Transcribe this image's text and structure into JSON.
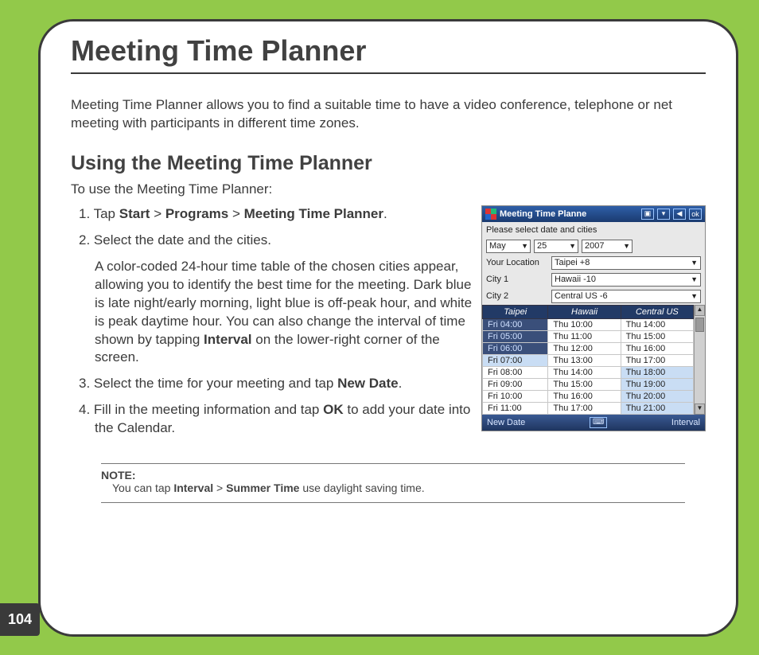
{
  "page": {
    "title": "Meeting Time Planner",
    "intro": "Meeting Time Planner allows you to find a suitable time to have a video conference, telephone or net meeting with participants in different time zones.",
    "section_heading": "Using the Meeting Time Planner",
    "section_lead": "To use the Meeting Time Planner:",
    "page_number": "104"
  },
  "steps": {
    "s1_prefix": "1.  Tap ",
    "s1_b1": "Start",
    "s1_sep1": " > ",
    "s1_b2": "Programs",
    "s1_sep2": " > ",
    "s1_b3": "Meeting Time Planner",
    "s1_end": ".",
    "s2": "2.   Select the date and the cities.",
    "s2_sub_a": "A color-coded 24-hour time table of the chosen cities appear, allowing you to identify the best time for the meeting. Dark blue is late night/early morning, light blue is off-peak hour, and white is peak daytime hour. You can also change the interval of time shown by tapping ",
    "s2_sub_bold": "Interval",
    "s2_sub_b": " on the lower-right corner of the screen.",
    "s3_a": "3. Select the time for your meeting and tap ",
    "s3_bold": "New Date",
    "s3_b": ".",
    "s4_a": "4. Fill in the meeting information and tap ",
    "s4_bold": "OK",
    "s4_b": " to add your date into the Calendar."
  },
  "note": {
    "label": "NOTE:",
    "a": "You can tap ",
    "b1": "Interval",
    "sep": " > ",
    "b2": "Summer Time",
    "c": " use daylight saving time."
  },
  "device": {
    "title": "Meeting Time Planne",
    "ok": "ok",
    "instruction": "Please select date and cities",
    "month": "May",
    "day": "25",
    "year": "2007",
    "loc_label": "Your Location",
    "city1_label": "City 1",
    "city2_label": "City 2",
    "loc_value": "Taipei +8",
    "city1_value": "Hawaii -10",
    "city2_value": "Central US -6",
    "headers": [
      "Taipei",
      "Hawaii",
      "Central US"
    ],
    "rows": [
      {
        "c0": "Fri 04:00",
        "c1": "Thu 10:00",
        "c2": "Thu 14:00",
        "cls": [
          "dk",
          "",
          ""
        ]
      },
      {
        "c0": "Fri 05:00",
        "c1": "Thu 11:00",
        "c2": "Thu 15:00",
        "cls": [
          "dk",
          "",
          ""
        ]
      },
      {
        "c0": "Fri 06:00",
        "c1": "Thu 12:00",
        "c2": "Thu 16:00",
        "cls": [
          "dk",
          "",
          ""
        ]
      },
      {
        "c0": "Fri 07:00",
        "c1": "Thu 13:00",
        "c2": "Thu 17:00",
        "cls": [
          "lt",
          "",
          ""
        ]
      },
      {
        "c0": "Fri 08:00",
        "c1": "Thu 14:00",
        "c2": "Thu 18:00",
        "cls": [
          "",
          "",
          "lt"
        ]
      },
      {
        "c0": "Fri 09:00",
        "c1": "Thu 15:00",
        "c2": "Thu 19:00",
        "cls": [
          "",
          "",
          "lt"
        ]
      },
      {
        "c0": "Fri 10:00",
        "c1": "Thu 16:00",
        "c2": "Thu 20:00",
        "cls": [
          "",
          "",
          "lt"
        ]
      },
      {
        "c0": "Fri 11:00",
        "c1": "Thu 17:00",
        "c2": "Thu 21:00",
        "cls": [
          "",
          "",
          "lt"
        ]
      }
    ],
    "bottom_left": "New Date",
    "bottom_right": "Interval"
  }
}
